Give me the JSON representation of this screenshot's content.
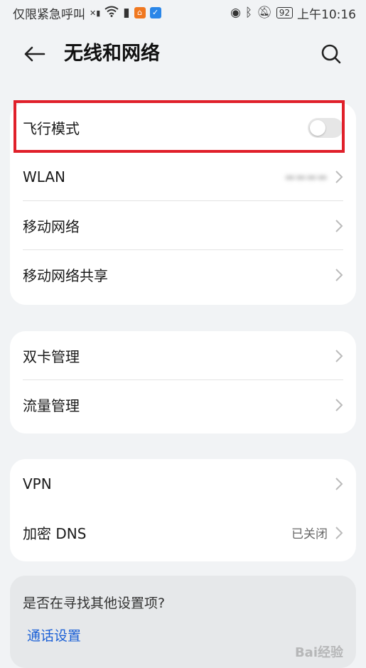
{
  "status_bar": {
    "carrier": "仅限紧急呼叫",
    "battery": "92",
    "time": "上午10:16"
  },
  "header": {
    "title": "无线和网络"
  },
  "sections": {
    "network": {
      "airplane": {
        "label": "飞行模式",
        "enabled": false
      },
      "wlan": {
        "label": "WLAN"
      },
      "mobile": {
        "label": "移动网络"
      },
      "tethering": {
        "label": "移动网络共享"
      }
    },
    "sim": {
      "dual_sim": {
        "label": "双卡管理"
      },
      "data_usage": {
        "label": "流量管理"
      }
    },
    "vpn_dns": {
      "vpn": {
        "label": "VPN"
      },
      "dns": {
        "label": "加密 DNS",
        "value": "已关闭"
      }
    }
  },
  "suggestion": {
    "question": "是否在寻找其他设置项?",
    "link": "通话设置"
  },
  "colors": {
    "highlight": "#e0202a",
    "link": "#1a5fd6"
  }
}
